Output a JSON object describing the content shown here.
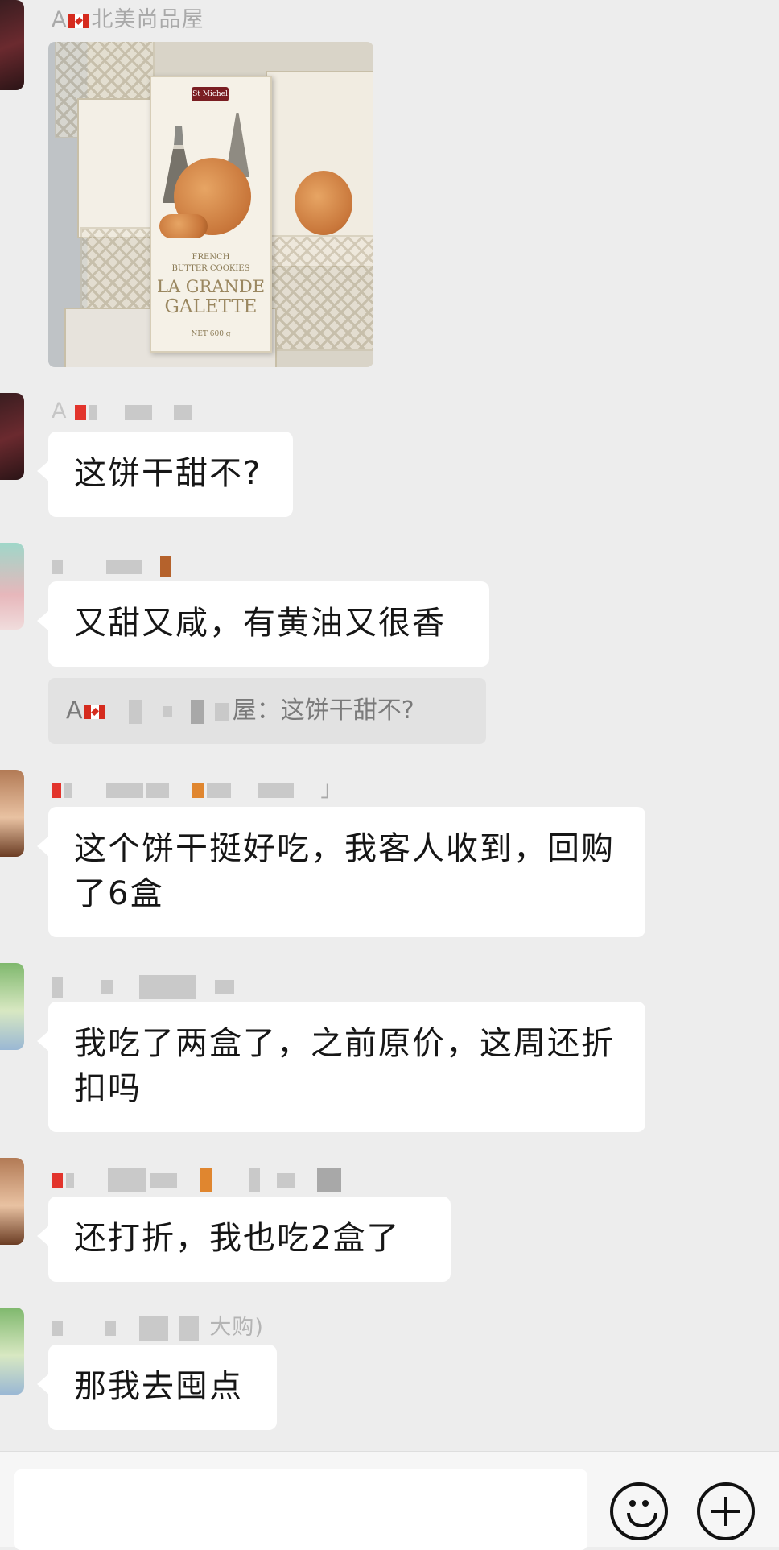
{
  "messages": [
    {
      "sender_visible": "A",
      "sender_tail": "北美尚品屋",
      "type": "image"
    },
    {
      "sender_visible": "A",
      "text": "这饼干甜不?"
    },
    {
      "text": "又甜又咸，有黄油又很香"
    },
    {
      "quote": "A",
      "quote_tail": "屋：这饼干甜不?"
    },
    {
      "sender_tail": "」",
      "text": "这个饼干挺好吃，我客人收到，回购了6盒"
    },
    {
      "text": "我吃了两盒了，之前原价，这周还折扣吗"
    },
    {
      "text": "还打折，我也吃2盒了"
    },
    {
      "sender_tail": "大购)",
      "text": "那我去囤点"
    }
  ],
  "photo": {
    "brand": "St Michel",
    "line1": "FRENCH",
    "line2": "BUTTER COOKIES",
    "line3": "LA GRANDE",
    "line4": "GALETTE",
    "net": "NET 600 g"
  },
  "input_bar": {
    "emoji_icon": "smiley-face-icon",
    "plus_icon": "plus-circle-icon"
  }
}
